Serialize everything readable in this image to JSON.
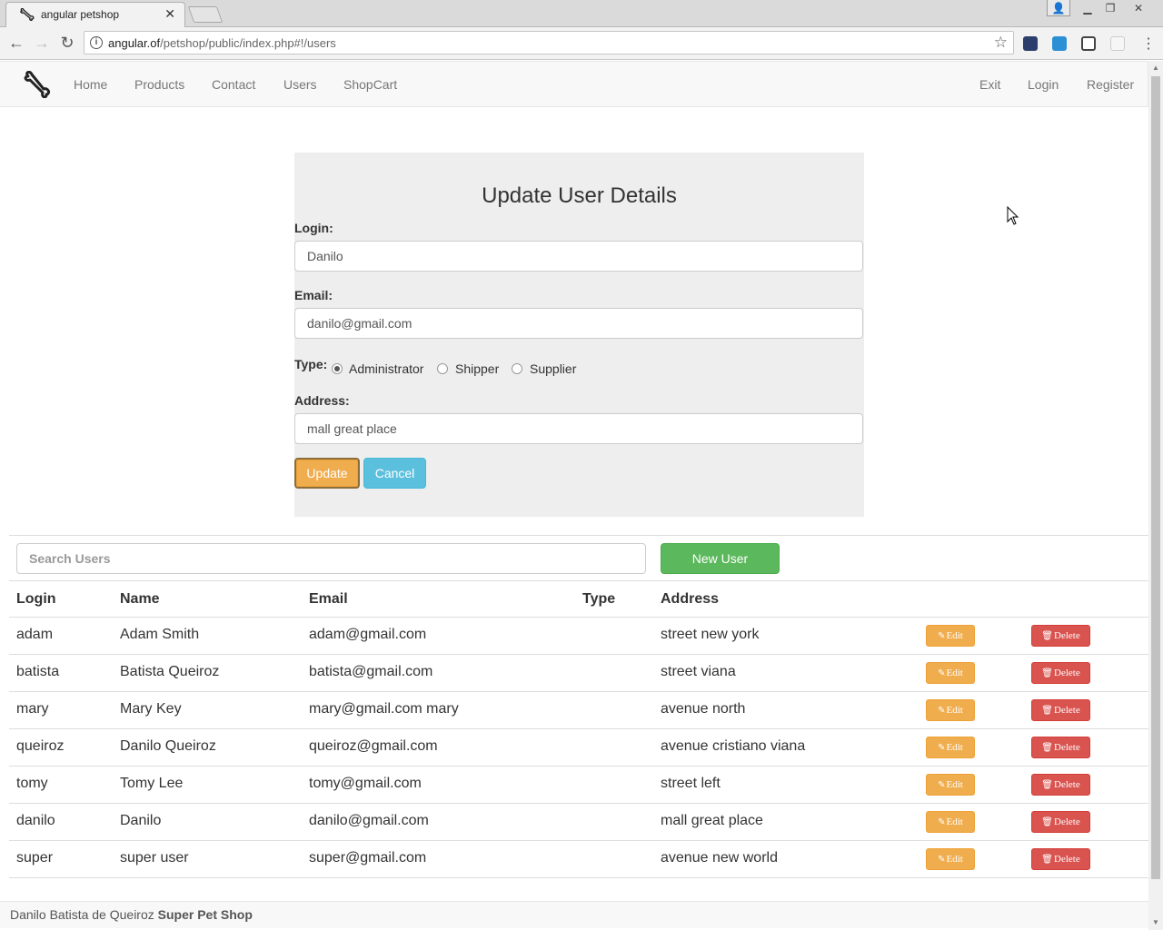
{
  "browser": {
    "tab_title": "angular petshop",
    "url_host": "angular.of",
    "url_path": "/petshop/public/index.php#!/users"
  },
  "navbar": {
    "left_links": [
      "Home",
      "Products",
      "Contact",
      "Users",
      "ShopCart"
    ],
    "right_links": [
      "Exit",
      "Login",
      "Register"
    ]
  },
  "form": {
    "title": "Update User Details",
    "login_label": "Login:",
    "login_value": "Danilo",
    "email_label": "Email:",
    "email_value": "danilo@gmail.com",
    "type_label": "Type:",
    "type_options": [
      "Administrator",
      "Shipper",
      "Supplier"
    ],
    "type_selected": "Administrator",
    "address_label": "Address:",
    "address_value": "mall great place",
    "update_label": "Update",
    "cancel_label": "Cancel"
  },
  "users": {
    "search_placeholder": "Search Users",
    "new_user_label": "New User",
    "columns": [
      "Login",
      "Name",
      "Email",
      "Type",
      "Address"
    ],
    "edit_label": "Edit",
    "delete_label": "Delete",
    "rows": [
      {
        "login": "adam",
        "name": "Adam Smith",
        "email": "adam@gmail.com",
        "type": "",
        "address": "street new york"
      },
      {
        "login": "batista",
        "name": "Batista Queiroz",
        "email": "batista@gmail.com",
        "type": "",
        "address": "street viana"
      },
      {
        "login": "mary",
        "name": "Mary Key",
        "email": "mary@gmail.com mary",
        "type": "",
        "address": "avenue north"
      },
      {
        "login": "queiroz",
        "name": "Danilo Queiroz",
        "email": "queiroz@gmail.com",
        "type": "",
        "address": "avenue cristiano viana"
      },
      {
        "login": "tomy",
        "name": "Tomy Lee",
        "email": "tomy@gmail.com",
        "type": "",
        "address": "street left"
      },
      {
        "login": "danilo",
        "name": "Danilo",
        "email": "danilo@gmail.com",
        "type": "",
        "address": "mall great place"
      },
      {
        "login": "super",
        "name": "super user",
        "email": "super@gmail.com",
        "type": "",
        "address": "avenue new world"
      }
    ]
  },
  "footer": {
    "author": "Danilo Batista de Queiroz",
    "shop_name": "Super Pet Shop"
  },
  "colors": {
    "warning": "#f0ad4e",
    "danger": "#d9534f",
    "info": "#5bc0de",
    "success": "#5cb85c",
    "panel_bg": "#eeeeee"
  },
  "icons": {
    "brand": "bone-icon",
    "edit": "edit-icon",
    "delete": "trash-icon"
  }
}
